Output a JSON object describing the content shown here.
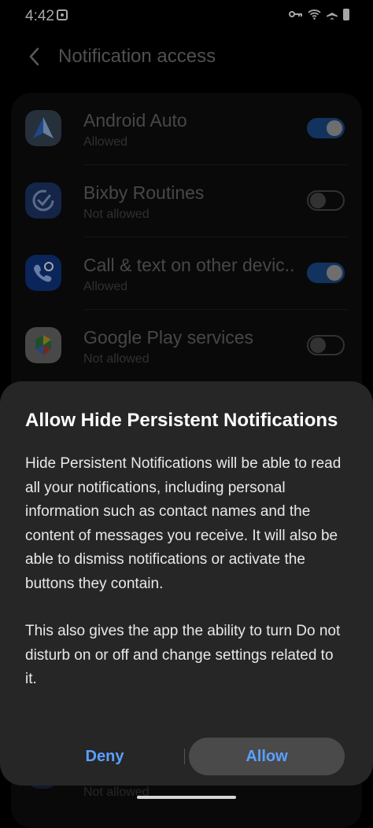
{
  "status_bar": {
    "time": "4:42"
  },
  "header": {
    "title": "Notification access"
  },
  "apps": [
    {
      "name": "Android Auto",
      "status": "Allowed",
      "enabled": true,
      "icon": "android-auto-icon"
    },
    {
      "name": "Bixby Routines",
      "status": "Not allowed",
      "enabled": false,
      "icon": "bixby-routines-icon"
    },
    {
      "name": "Call & text on other devic..",
      "status": "Allowed",
      "enabled": true,
      "icon": "call-text-icon"
    },
    {
      "name": "Google Play services",
      "status": "Not allowed",
      "enabled": false,
      "icon": "google-play-services-icon"
    }
  ],
  "peek_item": {
    "status": "Not allowed"
  },
  "dialog": {
    "title": "Allow Hide Persistent Notifications",
    "paragraph1": "Hide Persistent Notifications will be able to read all your notifications, including personal information such as contact names and the content of messages you receive. It will also be able to dismiss notifications or activate the buttons they contain.",
    "paragraph2": "This also gives the app the ability to turn Do not disturb on or off and change settings related to it.",
    "deny_label": "Deny",
    "allow_label": "Allow"
  },
  "colors": {
    "accent": "#5aa0ff",
    "toggle_on": "#1e4f93",
    "dialog_bg": "#262626"
  }
}
